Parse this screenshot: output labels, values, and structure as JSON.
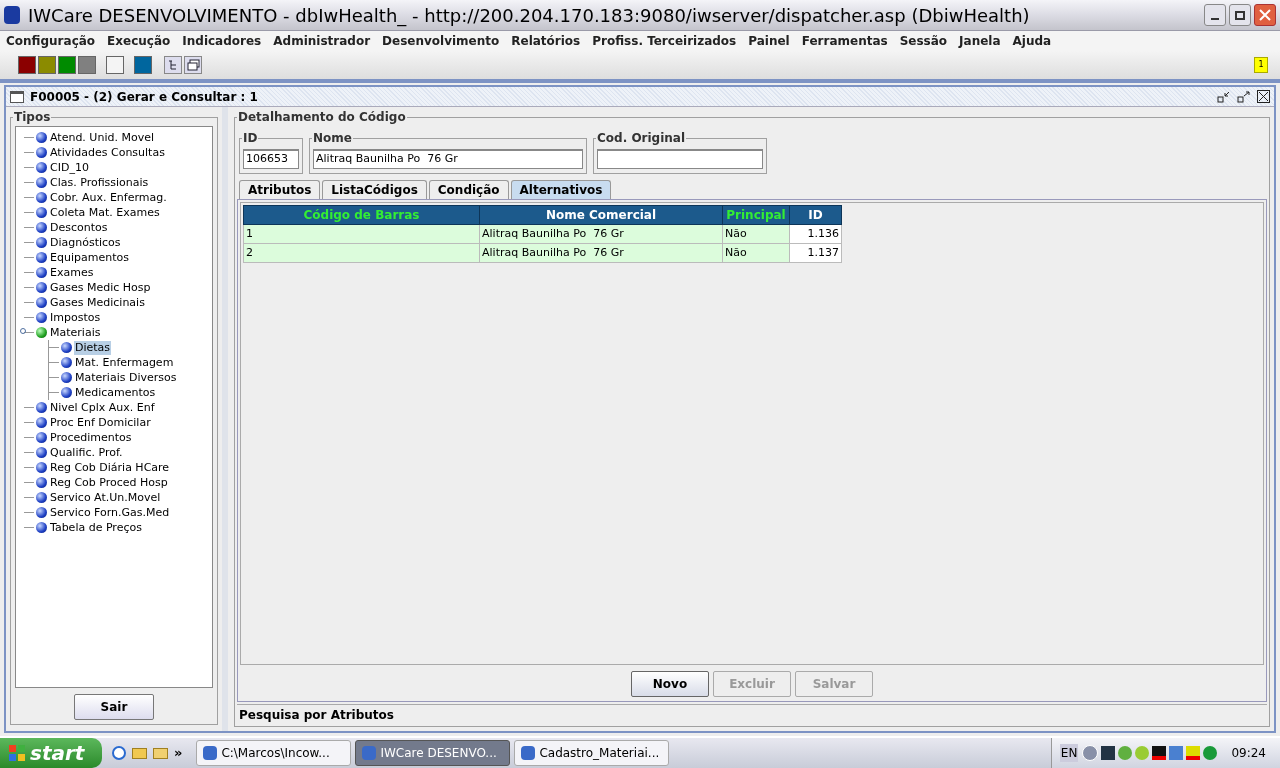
{
  "window": {
    "title": "IWCare DESENVOLVIMENTO - dbIwHealth_ - http://200.204.170.183:9080/iwserver/dispatcher.asp (DbiwHealth)"
  },
  "menu": [
    "Configuração",
    "Execução",
    "Indicadores",
    "Administrador",
    "Desenvolvimento",
    "Relatórios",
    "Profiss. Terceirizados",
    "Painel",
    "Ferramentas",
    "Sessão",
    "Janela",
    "Ajuda"
  ],
  "toolbar": {
    "swatches": [
      {
        "color": "#8b0000"
      },
      {
        "color": "#8b8b00"
      },
      {
        "color": "#008b00"
      },
      {
        "color": "#808080"
      },
      {
        "color": "#f4f4f4"
      },
      {
        "color": "#00669e"
      }
    ],
    "notification": "1"
  },
  "frame": {
    "title": "F00005 - (2) Gerar e Consultar : 1"
  },
  "tipos": {
    "title": "Tipos",
    "items": [
      {
        "label": "Atend. Unid. Movel",
        "selected": false
      },
      {
        "label": "Atividades Consultas",
        "selected": false
      },
      {
        "label": "CID_10",
        "selected": false
      },
      {
        "label": "Clas. Profissionais",
        "selected": false
      },
      {
        "label": "Cobr. Aux. Enfermag.",
        "selected": false
      },
      {
        "label": "Coleta Mat. Exames",
        "selected": false
      },
      {
        "label": "Descontos",
        "selected": false
      },
      {
        "label": "Diagnósticos",
        "selected": false
      },
      {
        "label": "Equipamentos",
        "selected": false
      },
      {
        "label": "Exames",
        "selected": false
      },
      {
        "label": "Gases Medic Hosp",
        "selected": false
      },
      {
        "label": "Gases Medicinais",
        "selected": false
      },
      {
        "label": "Impostos",
        "selected": false
      },
      {
        "label": "Materiais",
        "selected": false,
        "expanded": true,
        "children": [
          {
            "label": "Dietas",
            "selected": true
          },
          {
            "label": "Mat. Enfermagem",
            "selected": false
          },
          {
            "label": "Materiais Diversos",
            "selected": false
          },
          {
            "label": "Medicamentos",
            "selected": false
          }
        ]
      },
      {
        "label": "Nivel Cplx Aux. Enf",
        "selected": false
      },
      {
        "label": "Proc Enf Domicilar",
        "selected": false
      },
      {
        "label": "Procedimentos",
        "selected": false
      },
      {
        "label": "Qualific. Prof.",
        "selected": false
      },
      {
        "label": "Reg Cob Diária HCare",
        "selected": false
      },
      {
        "label": "Reg Cob Proced Hosp",
        "selected": false
      },
      {
        "label": "Servico At.Un.Movel",
        "selected": false
      },
      {
        "label": "Servico Forn.Gas.Med",
        "selected": false
      },
      {
        "label": "Tabela de Preços",
        "selected": false
      }
    ],
    "button": "Sair"
  },
  "detail": {
    "title": "Detalhamento do Código",
    "fields": [
      {
        "label": "ID",
        "value": "106653"
      },
      {
        "label": "Nome",
        "value": "Alitraq Baunilha Po  76 Gr"
      },
      {
        "label": "Cod. Original"
      }
    ],
    "tabs": [
      {
        "label": "Atributos",
        "selected": false
      },
      {
        "label": "ListaCódigos",
        "selected": false
      },
      {
        "label": "Condição",
        "selected": false
      },
      {
        "label": "Alternativos",
        "selected": true
      }
    ],
    "table": {
      "columns": [
        {
          "label": "Código de Barras",
          "highlighted": true
        },
        {
          "label": "Nome Comercial",
          "highlighted": false
        },
        {
          "label": "Principal",
          "highlighted": true
        },
        {
          "label": "ID",
          "highlighted": false
        }
      ],
      "rows": [
        [
          "1",
          "Alitraq Baunilha Po  76 Gr",
          "Não",
          "1.136"
        ],
        [
          "2",
          "Alitraq Baunilha Po  76 Gr",
          "Não",
          "1.137"
        ]
      ]
    },
    "buttons": [
      {
        "label": "Novo",
        "disabled": false
      },
      {
        "label": "Excluir",
        "disabled": true
      },
      {
        "label": "Salvar",
        "disabled": true
      }
    ],
    "search_section": "Pesquisa por Atributos"
  },
  "taskbar": {
    "start": "start",
    "quick_launch_more": "»",
    "tasks": [
      {
        "label": "C:\\Marcos\\Incow...",
        "selected": false
      },
      {
        "label": "IWCare DESENVO...",
        "selected": true
      },
      {
        "label": "Cadastro_Materiai...",
        "selected": false
      }
    ],
    "language": "EN",
    "clock": "09:24"
  }
}
